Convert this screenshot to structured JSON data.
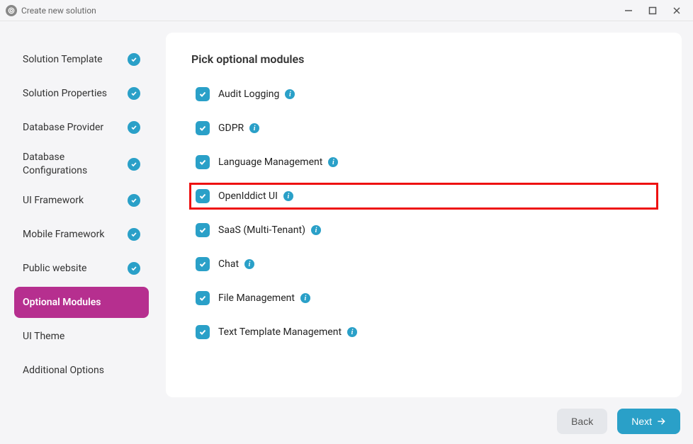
{
  "window": {
    "title": "Create new solution"
  },
  "sidebar": {
    "items": [
      {
        "label": "Solution Template",
        "completed": true,
        "active": false
      },
      {
        "label": "Solution Properties",
        "completed": true,
        "active": false
      },
      {
        "label": "Database Provider",
        "completed": true,
        "active": false
      },
      {
        "label": "Database Configurations",
        "completed": true,
        "active": false
      },
      {
        "label": "UI Framework",
        "completed": true,
        "active": false
      },
      {
        "label": "Mobile Framework",
        "completed": true,
        "active": false
      },
      {
        "label": "Public website",
        "completed": true,
        "active": false
      },
      {
        "label": "Optional Modules",
        "completed": false,
        "active": true
      },
      {
        "label": "UI Theme",
        "completed": false,
        "active": false
      },
      {
        "label": "Additional Options",
        "completed": false,
        "active": false
      }
    ]
  },
  "content": {
    "heading": "Pick optional modules",
    "modules": [
      {
        "label": "Audit Logging",
        "checked": true,
        "highlighted": false
      },
      {
        "label": "GDPR",
        "checked": true,
        "highlighted": false
      },
      {
        "label": "Language Management",
        "checked": true,
        "highlighted": false
      },
      {
        "label": "OpenIddict UI",
        "checked": true,
        "highlighted": true
      },
      {
        "label": "SaaS (Multi-Tenant)",
        "checked": true,
        "highlighted": false
      },
      {
        "label": "Chat",
        "checked": true,
        "highlighted": false
      },
      {
        "label": "File Management",
        "checked": true,
        "highlighted": false
      },
      {
        "label": "Text Template Management",
        "checked": true,
        "highlighted": false
      }
    ]
  },
  "footer": {
    "back_label": "Back",
    "next_label": "Next"
  }
}
